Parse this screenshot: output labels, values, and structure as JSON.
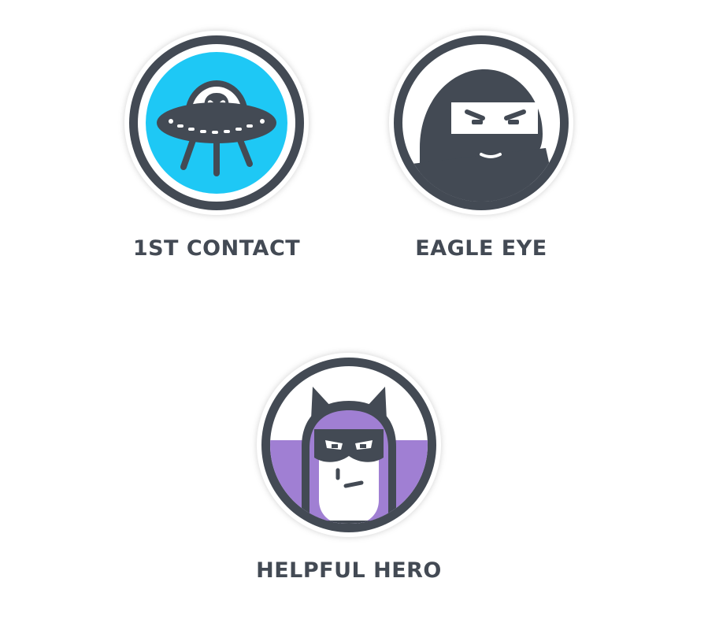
{
  "colors": {
    "dark": "#434a54",
    "ring_white": "#ffffff",
    "ufo_sky": "#1ec8f5",
    "hero_purple": "#a07fd3"
  },
  "badges": [
    {
      "label": "1ST CONTACT",
      "icon": "ufo-alien-icon"
    },
    {
      "label": "EAGLE EYE",
      "icon": "ninja-icon"
    },
    {
      "label": "HELPFUL HERO",
      "icon": "masked-hero-icon"
    }
  ]
}
